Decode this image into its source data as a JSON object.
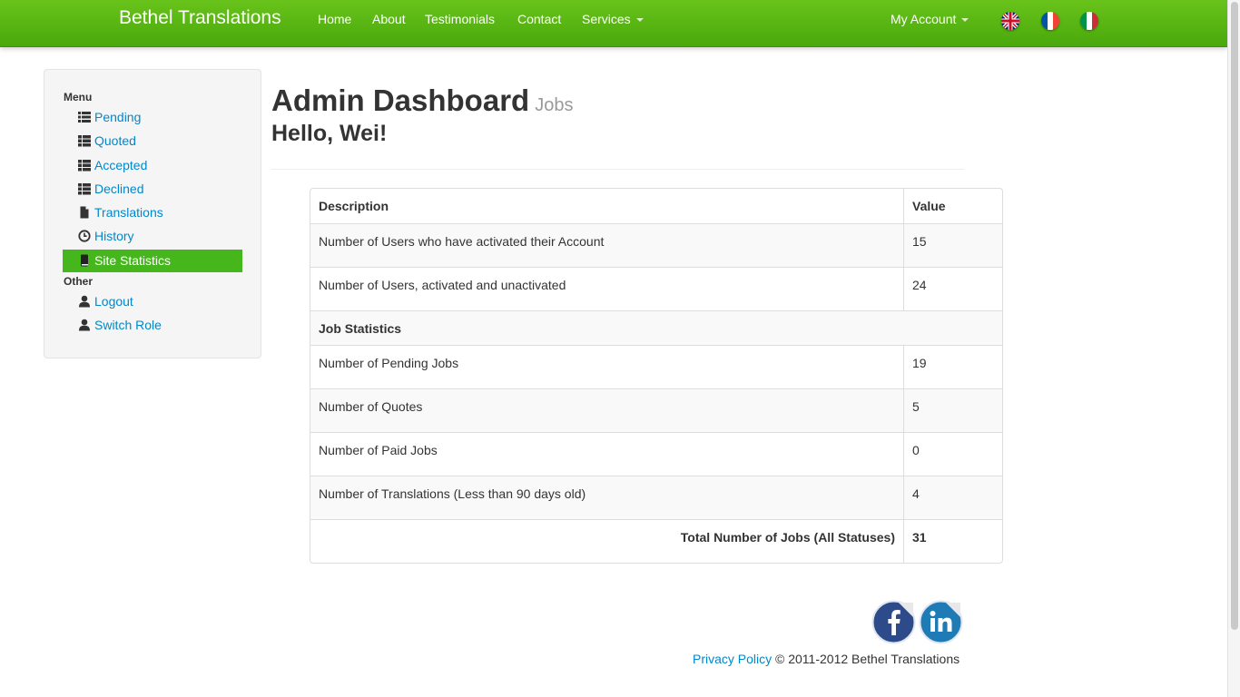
{
  "navbar": {
    "brand": "Bethel Translations",
    "items": [
      "Home",
      "About",
      "Testimonials",
      "Contact"
    ],
    "services_label": "Services",
    "account_label": "My Account",
    "color": "#52b013"
  },
  "sidebar": {
    "menu_header": "Menu",
    "menu_items": [
      {
        "label": "Pending",
        "icon": "list-icon"
      },
      {
        "label": "Quoted",
        "icon": "th-list-icon"
      },
      {
        "label": "Accepted",
        "icon": "th-list-icon"
      },
      {
        "label": "Declined",
        "icon": "th-list-icon"
      },
      {
        "label": "Translations",
        "icon": "file-icon"
      },
      {
        "label": "History",
        "icon": "clock-icon"
      },
      {
        "label": "Site Statistics",
        "icon": "book-icon",
        "active": true
      }
    ],
    "other_header": "Other",
    "other_items": [
      {
        "label": "Logout",
        "icon": "user-icon"
      },
      {
        "label": "Switch Role",
        "icon": "user-icon"
      }
    ],
    "active_color": "#46b61d"
  },
  "main": {
    "title": "Admin Dashboard",
    "subtitle": "Jobs",
    "greeting": "Hello, Wei!"
  },
  "table": {
    "headers": [
      "Description",
      "Value"
    ],
    "user_rows": [
      {
        "description": "Number of Users who have activated their Account",
        "value": "15"
      },
      {
        "description": "Number of Users, activated and unactivated",
        "value": "24"
      }
    ],
    "section_label": "Job Statistics",
    "job_rows": [
      {
        "description": "Number of Pending Jobs",
        "value": "19"
      },
      {
        "description": "Number of Quotes",
        "value": "5"
      },
      {
        "description": "Number of Paid Jobs",
        "value": "0"
      },
      {
        "description": "Number of Translations (Less than 90 days old)",
        "value": "4"
      }
    ],
    "total_label": "Total Number of Jobs (All Statuses)",
    "total_value": "31"
  },
  "footer": {
    "privacy_label": "Privacy Policy",
    "copyright": "© 2011-2012 Bethel Translations"
  }
}
